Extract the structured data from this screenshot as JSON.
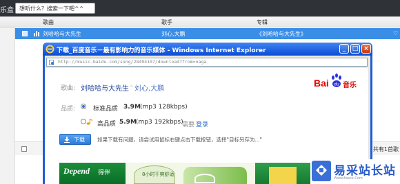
{
  "player": {
    "app_tag": "乐盒",
    "search_placeholder": "想听什么？搜索一下吧^^",
    "columns": {
      "song": "歌曲",
      "artist": "歌手",
      "album": "专辑"
    },
    "current_row": {
      "song": "刘哈哈与大先生",
      "artist": "刘心,大鹏",
      "album": "《刘哈哈与大先生》"
    },
    "total_text": "共有1首歌"
  },
  "ie": {
    "title": "下载_百度音乐－最有影响力的音乐媒体 - Windows Internet Explorer",
    "url": "http://music.baidu.com/song/28494107/download?from=naga",
    "minimize": "_",
    "maximize": "□",
    "close": "×"
  },
  "download": {
    "song_label": "歌曲:",
    "song_title": "刘哈哈与大先生",
    "separator": "-",
    "artist": "刘心,大鹏",
    "quality_label": "品质:",
    "qualities": [
      {
        "name": "标准品质",
        "size": "3.9M",
        "format": "(mp3 128kbps)"
      },
      {
        "name": "高品质",
        "size": "5.9M",
        "format": "(mp3 192kbps)"
      }
    ],
    "need_label": "需要",
    "login_label": "登录",
    "download_button": "下载",
    "tip": "如果下载有问题，请尝试用鼠标右键点击下载按钮，选择\"目标另存为...\""
  },
  "baidu_logo": {
    "bai": "Bai",
    "yue": "音乐",
    "color": "#e10601"
  },
  "ad": {
    "brand": "Depend",
    "brand_cn": "得伴",
    "slogan": "8小时干爽舒适"
  },
  "watermark": {
    "text": "易采站长站",
    "sub": "Www.Easck.Com"
  },
  "colors": {
    "selected_row": "#3a8ee6",
    "ie_blue": "#0a4cd6",
    "link_blue": "#1f3f9b"
  }
}
